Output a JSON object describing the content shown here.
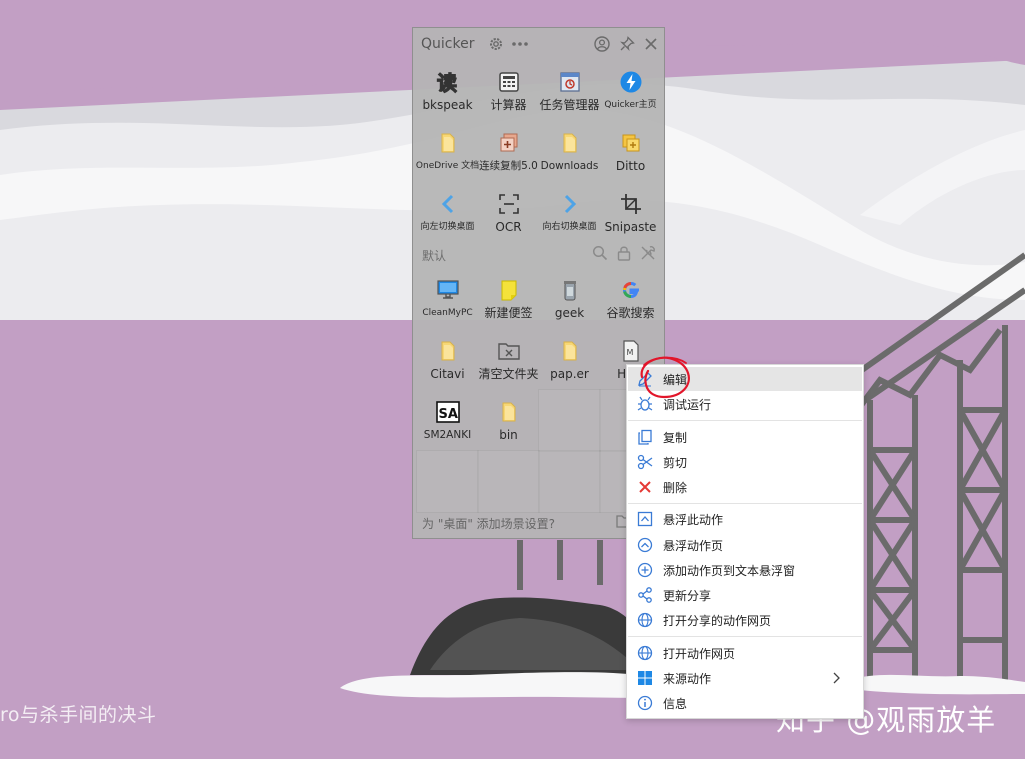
{
  "background": {
    "caption": "ro与杀手间的决斗",
    "watermark": "知乎 @观雨放羊",
    "colors": {
      "sky": "#c29fc4",
      "snow": "#ffffff",
      "structure": "#6b6b6b"
    }
  },
  "panel": {
    "title": "Quicker",
    "header_icons": [
      "gear-icon",
      "more-icon",
      "user-icon",
      "pin-icon",
      "close-icon"
    ],
    "group_label": "默认",
    "group_icons": [
      "search-icon",
      "lock-icon",
      "tools-icon"
    ],
    "footer_text": "为 \"桌面\" 添加场景设置?",
    "top_actions": [
      {
        "label": "bkspeak",
        "icon": "bkspeak-icon"
      },
      {
        "label": "计算器",
        "icon": "calculator-icon"
      },
      {
        "label": "任务管理器",
        "icon": "task-manager-icon"
      },
      {
        "label": "Quicker主页",
        "icon": "quicker-home-icon"
      },
      {
        "label": "OneDrive 文档",
        "icon": "folder-icon"
      },
      {
        "label": "连续复制5.0",
        "icon": "continuous-copy-icon"
      },
      {
        "label": "Downloads",
        "icon": "folder-icon"
      },
      {
        "label": "Ditto",
        "icon": "ditto-icon"
      },
      {
        "label": "向左切换桌面",
        "icon": "arrow-left-icon"
      },
      {
        "label": "OCR",
        "icon": "ocr-icon"
      },
      {
        "label": "向右切换桌面",
        "icon": "arrow-right-icon"
      },
      {
        "label": "Snipaste",
        "icon": "snipaste-icon"
      }
    ],
    "group_actions": [
      {
        "label": "CleanMyPC",
        "icon": "monitor-icon"
      },
      {
        "label": "新建便签",
        "icon": "sticky-note-icon"
      },
      {
        "label": "geek",
        "icon": "geek-icon"
      },
      {
        "label": "谷歌搜索",
        "icon": "google-icon"
      },
      {
        "label": "Citavi",
        "icon": "folder-icon"
      },
      {
        "label": "清空文件夹",
        "icon": "clear-folder-icon"
      },
      {
        "label": "pap.er",
        "icon": "folder-icon"
      },
      {
        "label": "HTM",
        "icon": "markdown-file-icon"
      },
      {
        "label": "SM2ANKI",
        "icon": "sa-icon"
      },
      {
        "label": "bin",
        "icon": "folder-icon"
      }
    ]
  },
  "context_menu": {
    "items": [
      {
        "label": "编辑",
        "icon": "edit-icon",
        "highlighted": true
      },
      {
        "label": "调试运行",
        "icon": "debug-icon"
      },
      {
        "label": "复制",
        "icon": "copy-icon"
      },
      {
        "label": "剪切",
        "icon": "scissors-icon"
      },
      {
        "label": "删除",
        "icon": "delete-icon"
      },
      {
        "label": "悬浮此动作",
        "icon": "float-action-icon"
      },
      {
        "label": "悬浮动作页",
        "icon": "float-page-icon"
      },
      {
        "label": "添加动作页到文本悬浮窗",
        "icon": "add-circle-icon"
      },
      {
        "label": "更新分享",
        "icon": "share-icon"
      },
      {
        "label": "打开分享的动作网页",
        "icon": "globe-icon"
      },
      {
        "label": "打开动作网页",
        "icon": "globe-icon"
      },
      {
        "label": "来源动作",
        "icon": "windows-icon",
        "has_submenu": true
      },
      {
        "label": "信息",
        "icon": "info-icon"
      }
    ]
  }
}
